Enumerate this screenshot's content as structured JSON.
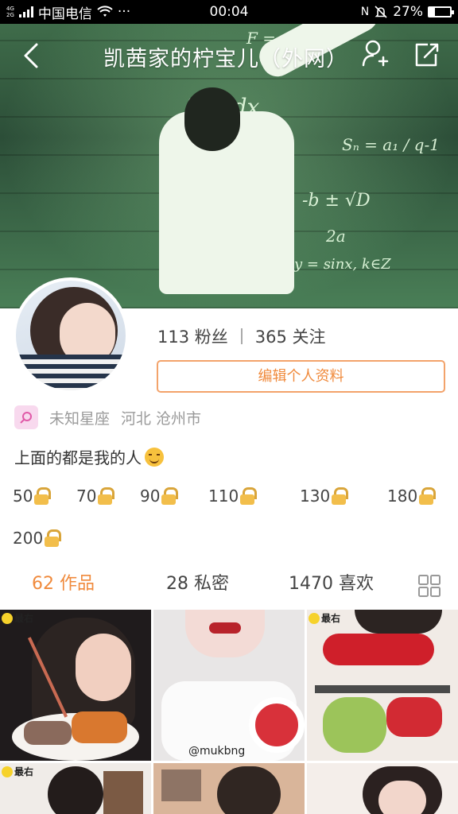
{
  "status_bar": {
    "network_top": "4G",
    "network_bottom": "2G",
    "carrier": "中国电信",
    "more": "···",
    "time": "00:04",
    "battery": "27%",
    "battery_level": 0.27
  },
  "header": {
    "title": "凯茜家的柠宝儿（外网）"
  },
  "profile": {
    "followers": "113 粉丝",
    "following": "365 关注",
    "edit_button": "编辑个人资料",
    "zodiac": "未知星座",
    "location": "河北 沧州市",
    "bio": "上面的都是我的人"
  },
  "locked_levels": [
    "50",
    "70",
    "90",
    "110",
    "130",
    "180",
    "200"
  ],
  "tabs": [
    {
      "label": "62 作品",
      "active": true
    },
    {
      "label": "28 私密",
      "active": false
    },
    {
      "label": "1470 喜欢",
      "active": false
    }
  ],
  "thumbnails": [
    {
      "badge": "最右",
      "caption": ""
    },
    {
      "badge": "",
      "caption": "@mukbng"
    },
    {
      "badge": "最右",
      "caption": ""
    },
    {
      "badge": "最右",
      "caption": ""
    },
    {
      "badge": "",
      "caption": ""
    },
    {
      "badge": "",
      "caption": ""
    }
  ],
  "colors": {
    "accent": "#f08a3c",
    "lock": "#f2be4b"
  }
}
